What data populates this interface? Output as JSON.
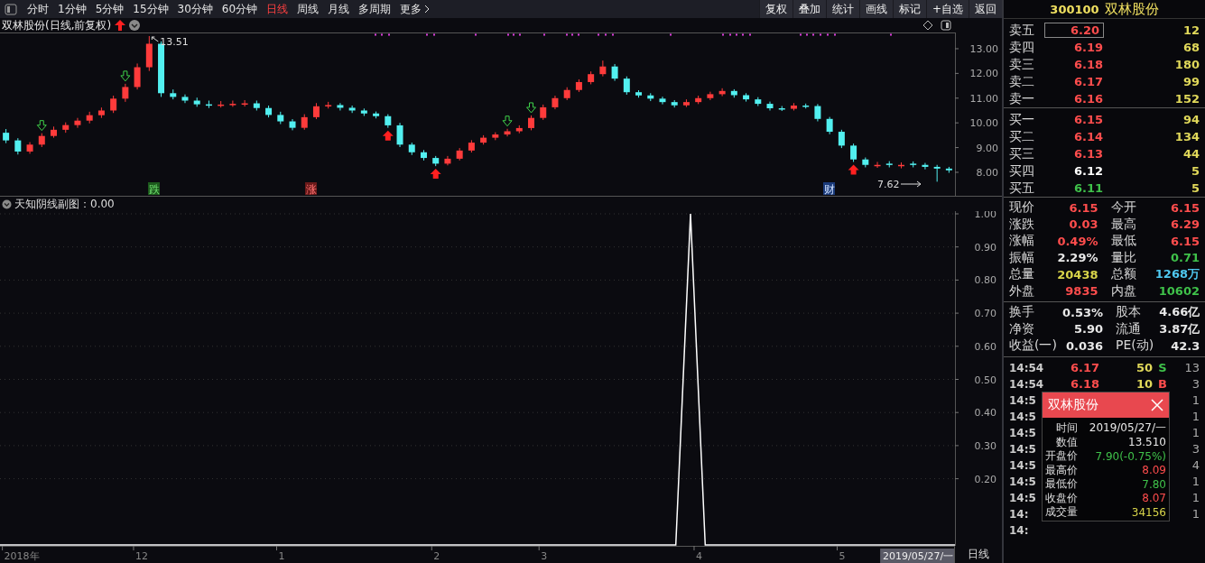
{
  "toolbar": {
    "periods": [
      {
        "label": "分时",
        "selected": false
      },
      {
        "label": "1分钟",
        "selected": false
      },
      {
        "label": "5分钟",
        "selected": false
      },
      {
        "label": "15分钟",
        "selected": false
      },
      {
        "label": "30分钟",
        "selected": false
      },
      {
        "label": "60分钟",
        "selected": false
      },
      {
        "label": "日线",
        "selected": true
      },
      {
        "label": "周线",
        "selected": false
      },
      {
        "label": "月线",
        "selected": false
      },
      {
        "label": "多周期",
        "selected": false
      },
      {
        "label": "更多",
        "selected": false,
        "kind": "more"
      }
    ],
    "actions": [
      "复权",
      "叠加",
      "统计",
      "画线",
      "标记",
      "+自选",
      "返回"
    ]
  },
  "chart": {
    "title": "双林股份(日线,前复权)",
    "high_label": "13.51",
    "low_label": "7.62",
    "signal_tags": [
      {
        "label": "跌",
        "kind": "fall"
      },
      {
        "label": "涨",
        "kind": "rise"
      },
      {
        "label": "财",
        "kind": "finance"
      }
    ],
    "chart_data": {
      "type": "candlestick",
      "ylim": [
        7.05,
        13.51
      ],
      "yticks": [
        {
          "value": 13,
          "label": "13.00"
        },
        {
          "value": 12,
          "label": "12.00"
        },
        {
          "value": 11,
          "label": "11.00"
        },
        {
          "value": 10,
          "label": "10.00"
        },
        {
          "value": 9,
          "label": "9.00"
        },
        {
          "value": 8,
          "label": "8.00"
        }
      ],
      "ohlc": [
        [
          9.6,
          9.75,
          9.18,
          9.29
        ],
        [
          9.29,
          9.38,
          8.72,
          8.84
        ],
        [
          8.84,
          9.22,
          8.75,
          9.12
        ],
        [
          9.12,
          9.58,
          9.02,
          9.47
        ],
        [
          9.47,
          9.85,
          9.4,
          9.72
        ],
        [
          9.72,
          10.02,
          9.6,
          9.91
        ],
        [
          9.91,
          10.2,
          9.8,
          10.09
        ],
        [
          10.09,
          10.45,
          9.98,
          10.31
        ],
        [
          10.31,
          10.62,
          10.2,
          10.5
        ],
        [
          10.5,
          11.1,
          10.4,
          10.98
        ],
        [
          10.98,
          11.58,
          10.85,
          11.45
        ],
        [
          11.45,
          12.4,
          11.35,
          12.25
        ],
        [
          12.25,
          13.51,
          12.1,
          13.2
        ],
        [
          13.2,
          13.3,
          11.05,
          11.2
        ],
        [
          11.2,
          11.35,
          10.95,
          11.05
        ],
        [
          11.05,
          11.15,
          10.8,
          10.9
        ],
        [
          10.9,
          11.02,
          10.65,
          10.75
        ],
        [
          10.75,
          10.9,
          10.6,
          10.72
        ],
        [
          10.72,
          10.88,
          10.62,
          10.74
        ],
        [
          10.74,
          10.9,
          10.65,
          10.77
        ],
        [
          10.77,
          10.92,
          10.66,
          10.79
        ],
        [
          10.79,
          10.9,
          10.5,
          10.6
        ],
        [
          10.6,
          10.7,
          10.22,
          10.32
        ],
        [
          10.32,
          10.45,
          9.95,
          10.06
        ],
        [
          10.06,
          10.15,
          9.7,
          9.8
        ],
        [
          9.8,
          10.35,
          9.72,
          10.23
        ],
        [
          10.23,
          10.8,
          10.15,
          10.67
        ],
        [
          10.67,
          10.85,
          10.58,
          10.72
        ],
        [
          10.72,
          10.8,
          10.5,
          10.61
        ],
        [
          10.61,
          10.7,
          10.4,
          10.5
        ],
        [
          10.5,
          10.58,
          10.28,
          10.38
        ],
        [
          10.38,
          10.46,
          10.18,
          10.27
        ],
        [
          10.27,
          10.35,
          9.8,
          9.9
        ],
        [
          9.9,
          10.0,
          9.02,
          9.12
        ],
        [
          9.12,
          9.2,
          8.7,
          8.81
        ],
        [
          8.81,
          8.9,
          8.48,
          8.58
        ],
        [
          8.58,
          8.66,
          8.25,
          8.35
        ],
        [
          8.35,
          8.66,
          8.28,
          8.55
        ],
        [
          8.55,
          8.98,
          8.48,
          8.88
        ],
        [
          8.88,
          9.3,
          8.8,
          9.2
        ],
        [
          9.2,
          9.5,
          9.12,
          9.4
        ],
        [
          9.4,
          9.62,
          9.3,
          9.53
        ],
        [
          9.53,
          9.76,
          9.45,
          9.66
        ],
        [
          9.66,
          9.9,
          9.58,
          9.79
        ],
        [
          9.79,
          10.3,
          9.7,
          10.2
        ],
        [
          10.2,
          10.74,
          10.12,
          10.63
        ],
        [
          10.63,
          11.1,
          10.55,
          11.0
        ],
        [
          11.0,
          11.44,
          10.92,
          11.33
        ],
        [
          11.33,
          11.76,
          11.25,
          11.65
        ],
        [
          11.65,
          12.08,
          11.56,
          11.97
        ],
        [
          11.97,
          12.52,
          11.88,
          12.28
        ],
        [
          12.28,
          12.38,
          11.7,
          11.79
        ],
        [
          11.79,
          11.88,
          11.14,
          11.24
        ],
        [
          11.24,
          11.32,
          11.02,
          11.11
        ],
        [
          11.11,
          11.2,
          10.88,
          10.98
        ],
        [
          10.98,
          11.06,
          10.75,
          10.84
        ],
        [
          10.84,
          10.92,
          10.62,
          10.71
        ],
        [
          10.71,
          10.95,
          10.64,
          10.84
        ],
        [
          10.84,
          11.1,
          10.76,
          11.0
        ],
        [
          11.0,
          11.26,
          10.92,
          11.16
        ],
        [
          11.16,
          11.4,
          11.08,
          11.29
        ],
        [
          11.29,
          11.36,
          11.02,
          11.12
        ],
        [
          11.12,
          11.2,
          10.86,
          10.95
        ],
        [
          10.95,
          11.04,
          10.68,
          10.77
        ],
        [
          10.77,
          10.86,
          10.5,
          10.59
        ],
        [
          10.59,
          10.68,
          10.48,
          10.57
        ],
        [
          10.57,
          10.8,
          10.5,
          10.7
        ],
        [
          10.7,
          10.78,
          10.58,
          10.68
        ],
        [
          10.68,
          10.76,
          10.06,
          10.16
        ],
        [
          10.16,
          10.24,
          9.54,
          9.64
        ],
        [
          9.64,
          9.72,
          8.98,
          9.08
        ],
        [
          9.08,
          9.16,
          8.42,
          8.52
        ],
        [
          8.52,
          8.6,
          8.2,
          8.3
        ],
        [
          8.25,
          8.42,
          8.18,
          8.3
        ],
        [
          8.35,
          8.45,
          8.2,
          8.3
        ],
        [
          8.25,
          8.4,
          8.16,
          8.3
        ],
        [
          8.35,
          8.44,
          8.2,
          8.3
        ],
        [
          8.3,
          8.38,
          8.12,
          8.22
        ],
        [
          8.22,
          8.3,
          7.62,
          8.15
        ],
        [
          8.15,
          8.22,
          7.98,
          8.08
        ]
      ]
    }
  },
  "indicator": {
    "title": "天知阴线副图：0.00",
    "chart_data": {
      "type": "line",
      "ylim": [
        0,
        1
      ],
      "grid": true,
      "yticks": [
        {
          "value": 1,
          "label": "1.00"
        },
        {
          "value": 0.9,
          "label": "0.90"
        },
        {
          "value": 0.8,
          "label": "0.80"
        },
        {
          "value": 0.7,
          "label": "0.70"
        },
        {
          "value": 0.6,
          "label": "0.60"
        },
        {
          "value": 0.5,
          "label": "0.50"
        },
        {
          "value": 0.4,
          "label": "0.40"
        },
        {
          "value": 0.3,
          "label": "0.30"
        },
        {
          "value": 0.2,
          "label": "0.20"
        }
      ],
      "series": [
        {
          "color": "#ffffff",
          "values": [
            0,
            0,
            0,
            0,
            0,
            0,
            0,
            0,
            0,
            0,
            0,
            0,
            0,
            0,
            0,
            0,
            0,
            0,
            0,
            0,
            0,
            0,
            0,
            0,
            0,
            0,
            0,
            0,
            0,
            0,
            0,
            0,
            0,
            0,
            0,
            0,
            0,
            0,
            0,
            0,
            0,
            0,
            0,
            0,
            0,
            0,
            0,
            1,
            0,
            0,
            0,
            0,
            0,
            0,
            0,
            0,
            0,
            0,
            0,
            0,
            0,
            0,
            0,
            0,
            0,
            0
          ]
        }
      ]
    }
  },
  "time_axis": {
    "labels": [
      "2018年",
      "12",
      "1",
      "2",
      "3",
      "4",
      "5"
    ],
    "cursor_date": "2019/05/27/一",
    "period": "日线"
  },
  "quote": {
    "code": "300100",
    "name": "双林股份",
    "asks": [
      {
        "label": "卖五",
        "price": "6.20",
        "volume": "12",
        "color": "#ff4d4d",
        "selected": true
      },
      {
        "label": "卖四",
        "price": "6.19",
        "volume": "68",
        "color": "#ff4d4d",
        "selected": false
      },
      {
        "label": "卖三",
        "price": "6.18",
        "volume": "180",
        "color": "#ff4d4d",
        "selected": false
      },
      {
        "label": "卖二",
        "price": "6.17",
        "volume": "99",
        "color": "#ff4d4d",
        "selected": false
      },
      {
        "label": "卖一",
        "price": "6.16",
        "volume": "152",
        "color": "#ff4d4d",
        "selected": false
      }
    ],
    "bids": [
      {
        "label": "买一",
        "price": "6.15",
        "volume": "94",
        "color": "#ff4d4d",
        "selected": false
      },
      {
        "label": "买二",
        "price": "6.14",
        "volume": "134",
        "color": "#ff4d4d",
        "selected": false
      },
      {
        "label": "买三",
        "price": "6.13",
        "volume": "44",
        "color": "#ff4d4d",
        "selected": false
      },
      {
        "label": "买四",
        "price": "6.12",
        "volume": "5",
        "color": "#ffffff",
        "selected": false
      },
      {
        "label": "买五",
        "price": "6.11",
        "volume": "5",
        "color": "#3fc14a",
        "selected": false
      }
    ],
    "stats": [
      {
        "label": "现价",
        "value": "6.15",
        "color": "#ff4d4d"
      },
      {
        "label": "今开",
        "value": "6.15",
        "color": "#ff4d4d"
      },
      {
        "label": "涨跌",
        "value": "0.03",
        "color": "#ff4d4d"
      },
      {
        "label": "最高",
        "value": "6.29",
        "color": "#ff4d4d"
      },
      {
        "label": "涨幅",
        "value": "0.49%",
        "color": "#ff4d4d"
      },
      {
        "label": "最低",
        "value": "6.15",
        "color": "#ff4d4d"
      },
      {
        "label": "振幅",
        "value": "2.29%",
        "color": "#e8e8e8"
      },
      {
        "label": "量比",
        "value": "0.71",
        "color": "#3fc14a"
      },
      {
        "label": "总量",
        "value": "20438",
        "color": "#d8d44a"
      },
      {
        "label": "总额",
        "value": "1268万",
        "color": "#4fc8f0"
      },
      {
        "label": "外盘",
        "value": "9835",
        "color": "#ff4d4d"
      },
      {
        "label": "内盘",
        "value": "10602",
        "color": "#3fc14a"
      }
    ],
    "fundamentals": [
      {
        "label": "换手",
        "value": "0.53%"
      },
      {
        "label": "股本",
        "value": "4.66亿"
      },
      {
        "label": "净资",
        "value": "5.90"
      },
      {
        "label": "流通",
        "value": "3.87亿"
      },
      {
        "label": "收益(一)",
        "value": "0.036"
      },
      {
        "label": "PE(动)",
        "value": "42.3"
      }
    ],
    "trades": [
      {
        "time": "14:54",
        "price": "6.17",
        "volume": "50",
        "side": "S",
        "count": "13"
      },
      {
        "time": "14:54",
        "price": "6.18",
        "volume": "10",
        "side": "B",
        "count": "3"
      },
      {
        "time": "14:5",
        "count": "1"
      },
      {
        "time": "14:5",
        "count": "1"
      },
      {
        "time": "14:5",
        "count": "1"
      },
      {
        "time": "14:5",
        "count": "3"
      },
      {
        "time": "14:5",
        "count": "4"
      },
      {
        "time": "14:5",
        "count": "1"
      },
      {
        "time": "14:5",
        "count": "1"
      },
      {
        "time": "14:",
        "count": "1"
      },
      {
        "time": "14:"
      }
    ]
  },
  "tooltip": {
    "title": "双林股份",
    "rows": [
      {
        "label": "时间",
        "value": "2019/05/27/一",
        "color": "#e8e8e8"
      },
      {
        "label": "数值",
        "value": "13.510",
        "color": "#e8e8e8"
      },
      {
        "label": "开盘价",
        "value": "7.90(-0.75%)",
        "color": "#3fc14a"
      },
      {
        "label": "最高价",
        "value": "8.09",
        "color": "#ff4d4d"
      },
      {
        "label": "最低价",
        "value": "7.80",
        "color": "#3fc14a"
      },
      {
        "label": "收盘价",
        "value": "8.07",
        "color": "#ff4d4d"
      },
      {
        "label": "成交量",
        "value": "34156",
        "color": "#d8d44a"
      }
    ]
  }
}
